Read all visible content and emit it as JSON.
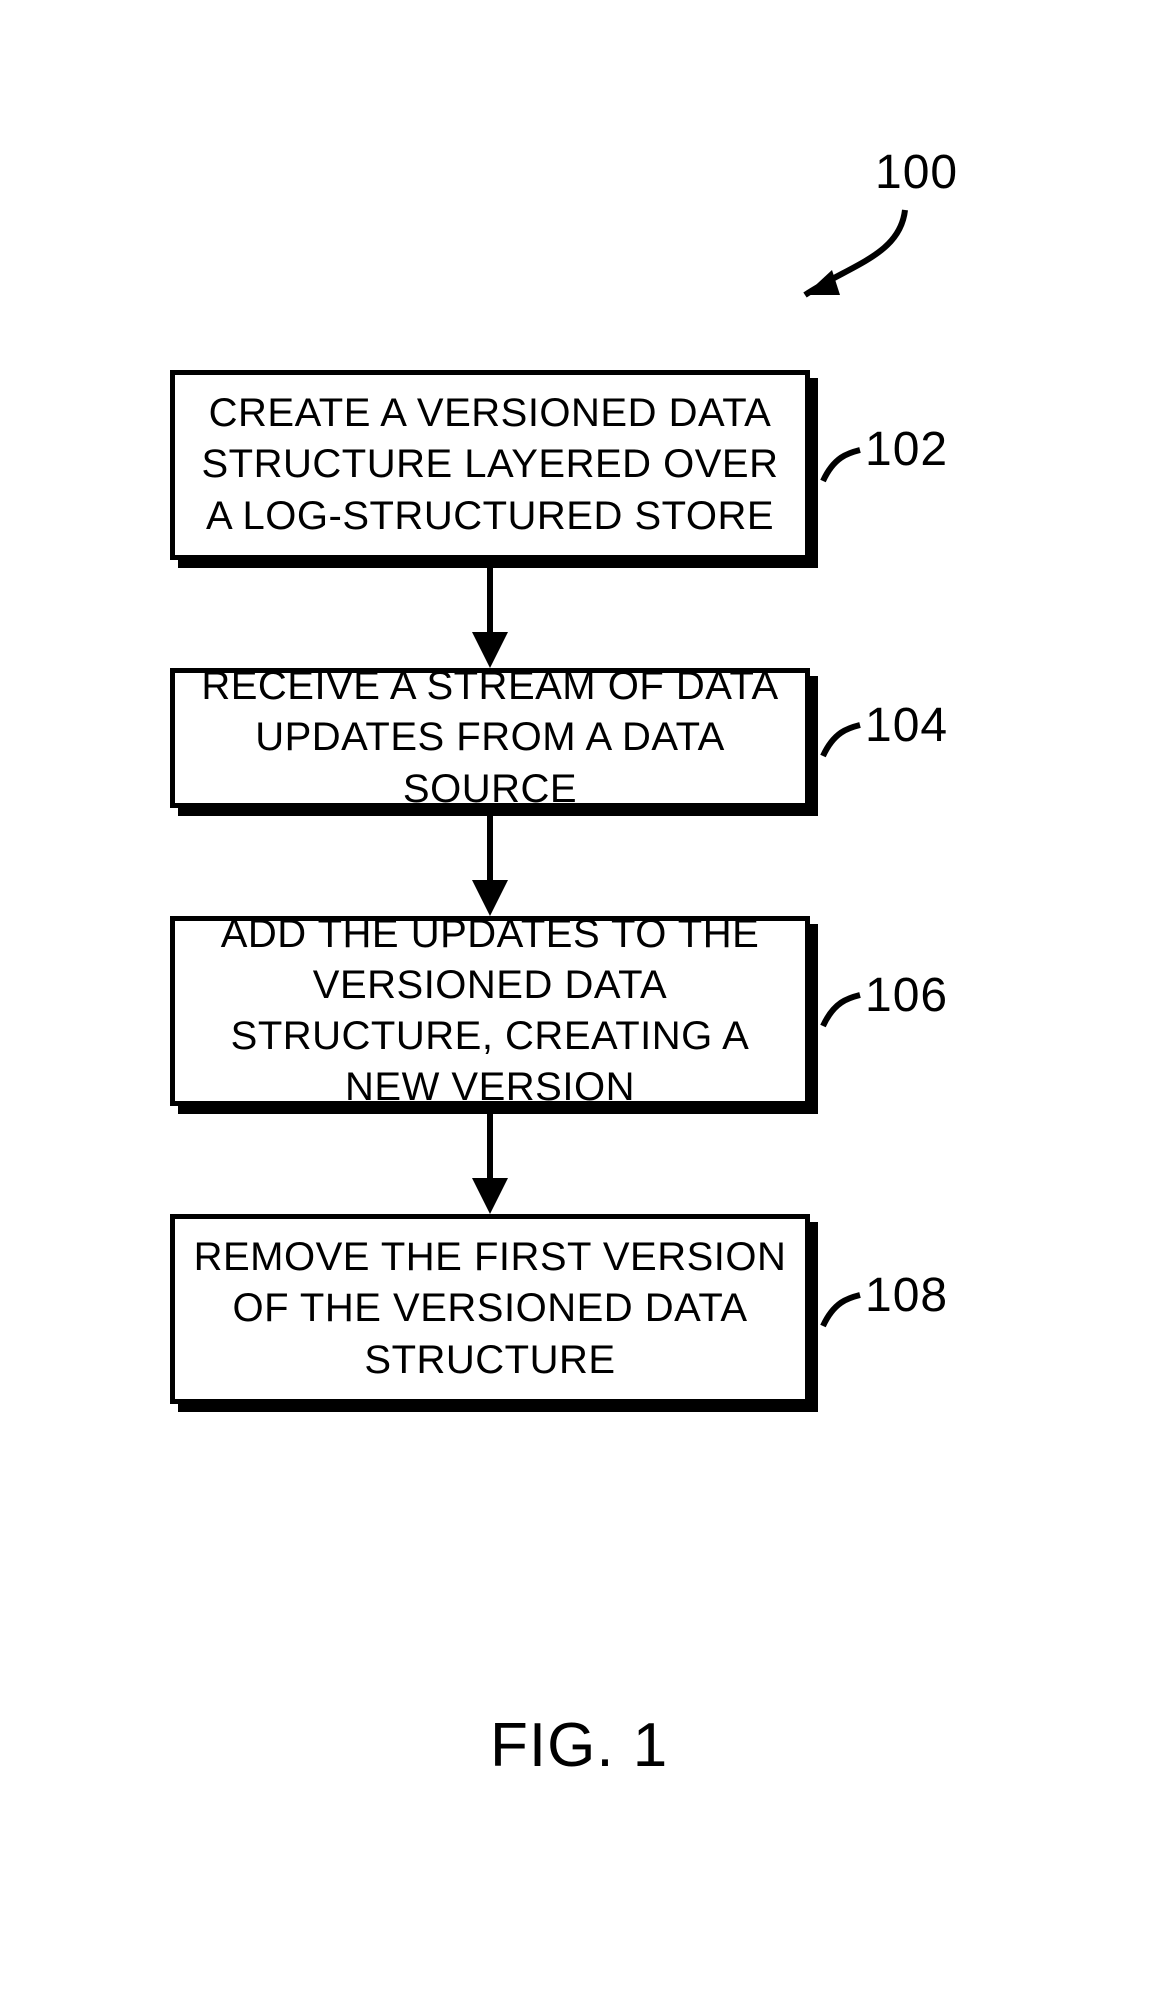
{
  "diagram": {
    "reference": "100",
    "caption": "FIG. 1",
    "steps": [
      {
        "ref": "102",
        "text": "CREATE A VERSIONED DATA STRUCTURE LAYERED OVER A LOG-STRUCTURED STORE"
      },
      {
        "ref": "104",
        "text": "RECEIVE A STREAM OF DATA UPDATES FROM A DATA SOURCE"
      },
      {
        "ref": "106",
        "text": "ADD THE UPDATES TO THE VERSIONED DATA STRUCTURE, CREATING A NEW VERSION"
      },
      {
        "ref": "108",
        "text": "REMOVE THE FIRST VERSION OF THE VERSIONED DATA STRUCTURE"
      }
    ]
  }
}
